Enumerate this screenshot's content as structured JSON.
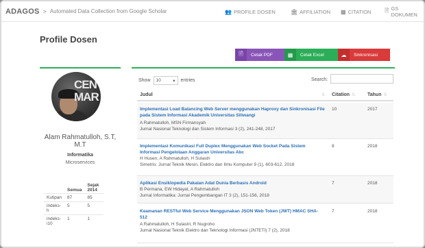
{
  "topbar": {
    "brand": "ADAGOS",
    "separator": ">",
    "subtitle": "Automated Data Collection from Google Scholar",
    "nav": [
      {
        "label": "PROFILE DOSEN",
        "icon": "people-icon"
      },
      {
        "label": "AFFILIATION",
        "icon": "institution-icon"
      },
      {
        "label": "CITATION",
        "icon": "bar-chart-icon"
      },
      {
        "label": "GS DOKUMEN",
        "icon": "document-icon"
      }
    ]
  },
  "page_title": "Profile Dosen",
  "actions": {
    "pdf_label": "Cetak PDF",
    "excel_label": "Cetak Excel",
    "sync_label": "Sinkronisasi"
  },
  "profile": {
    "avatar_text": "CENT MAR",
    "name": "Alam Rahmatulloh, S.T, M.T",
    "department": "Informatika",
    "group": "Microservices"
  },
  "stats": {
    "headers": [
      "",
      "Semua",
      "Sejak 2014"
    ],
    "rows": [
      {
        "label": "Kutipan",
        "all": "87",
        "since": "85"
      },
      {
        "label": "indeks-h",
        "all": "5",
        "since": "5"
      },
      {
        "label": "indeks-i10",
        "all": "1",
        "since": "1"
      }
    ]
  },
  "table": {
    "show_label": "Show",
    "entries_value": "10",
    "entries_label": "entries",
    "search_label": "Search:",
    "columns": {
      "judul": "Judul",
      "citation": "Citation",
      "tahun": "Tahun"
    },
    "rows": [
      {
        "title": "Implementasi Load Balancing Web Server menggunakan Haproxy dan Sinkronisasi File pada Sistem Informasi Akademik Universitas Siliwangi",
        "authors": "A Rahmatulloh, MSN Firmansyah",
        "venue": "Jurnal Nasional Teknologi dan Sistem Informasi 3 (2), 241-248, 2017",
        "citation": "10",
        "year": "2017"
      },
      {
        "title": "Implementasi Komunikasi Full Duplex Menggunakan Web Socket Pada Sistem Informasi Pengelolaan Anggaran Universitas Abc",
        "authors": "H Husen, A Rahmatulloh, H Sulastri",
        "venue": "Simetris: Jurnal Teknik Mesin, Elektro dan Ilmu Komputer 9 (1), 603-612, 2018",
        "citation": "8",
        "year": "2018"
      },
      {
        "title": "Aplikasi Ensiklopedia Pakaian Adat Dunia Berbasis Android",
        "authors": "B Permana, EW Hidayat, A Rahmatulloh",
        "venue": "Jurnal Informatika: Jurnal Pengembangan IT 3 (2), 151-156, 2018",
        "citation": "7",
        "year": "2018"
      },
      {
        "title": "Keamanan RESTful Web Service Menggunakan JSON Web Token (JWT) HMAC SHA-512",
        "authors": "A Rahmatulloh, H Sulastri, R Nugroho",
        "venue": "Jurnal Nasional Teknik Elektro dan Teknologi Informasi (JNTETI) 7 (2), 2018",
        "citation": "7",
        "year": "2018"
      }
    ]
  }
}
